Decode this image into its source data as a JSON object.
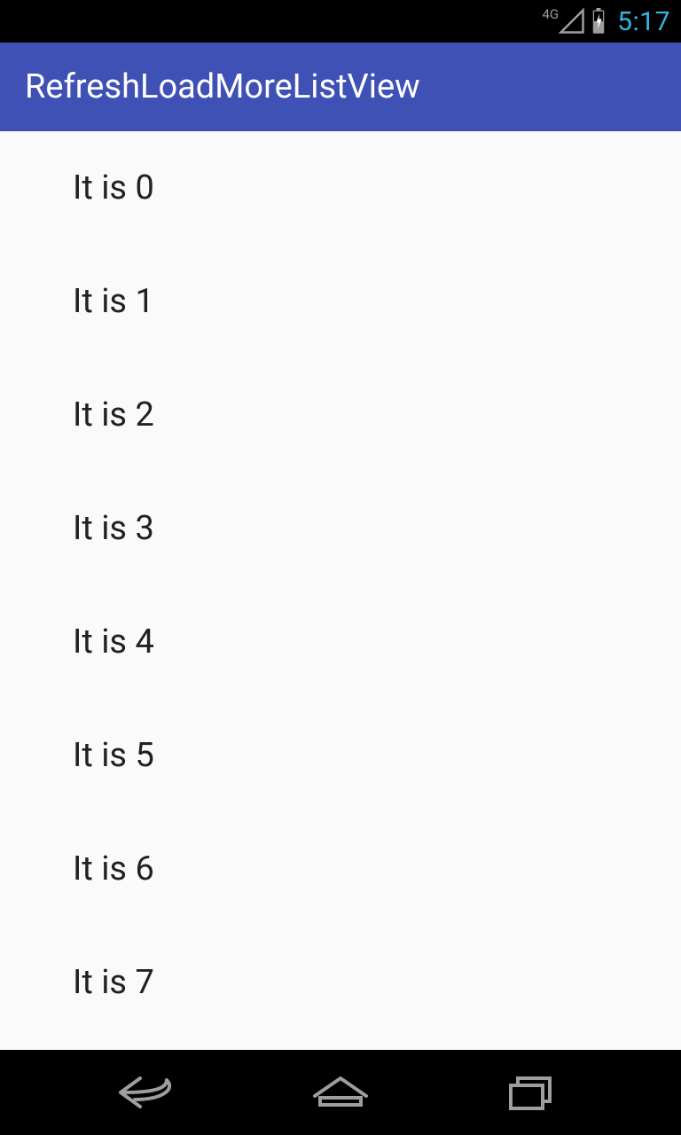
{
  "status_bar": {
    "network_label": "4G",
    "time": "5:17"
  },
  "app_bar": {
    "title": "RefreshLoadMoreListView"
  },
  "list": {
    "items": [
      {
        "label": "It is 0"
      },
      {
        "label": "It is 1"
      },
      {
        "label": "It is 2"
      },
      {
        "label": "It is 3"
      },
      {
        "label": "It is 4"
      },
      {
        "label": "It is 5"
      },
      {
        "label": "It is 6"
      },
      {
        "label": "It is 7"
      }
    ]
  }
}
